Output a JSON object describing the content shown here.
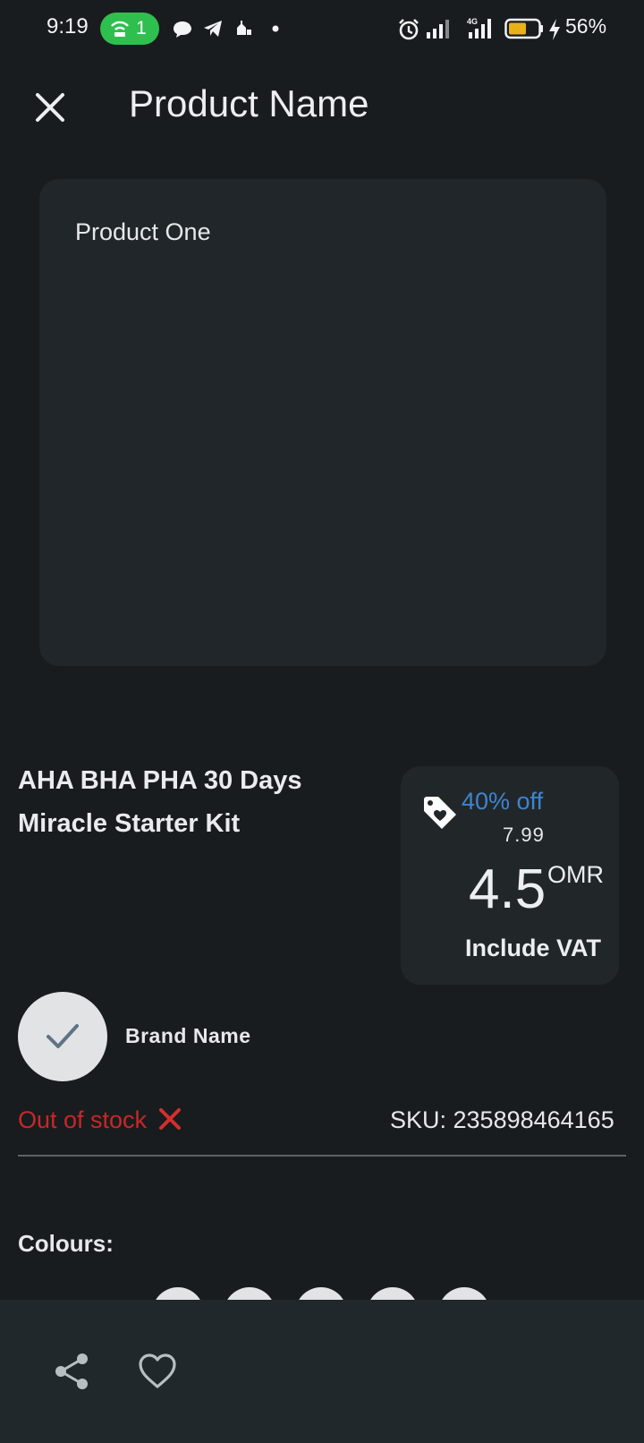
{
  "status_bar": {
    "time": "9:19",
    "hotspot_count": "1",
    "battery": "56%",
    "icons": [
      "hotspot-icon",
      "chat-icon",
      "telegram-icon",
      "notification-icon",
      "dot-icon",
      "alarm-icon",
      "signal-icon",
      "signal-4g-icon",
      "battery-icon",
      "charging-icon"
    ]
  },
  "header": {
    "title": "Product Name",
    "close_icon": "close-icon"
  },
  "image": {
    "label": "Product One"
  },
  "product": {
    "title": "AHA BHA PHA 30 Days Miracle Starter Kit"
  },
  "price": {
    "discount": "40% off",
    "old_price": "7.99",
    "value": "4.5",
    "currency": "OMR",
    "vat_note": "Include VAT",
    "tag_icon": "price-tag-heart-icon"
  },
  "brand": {
    "name": "Brand Name",
    "logo_icon": "check-icon"
  },
  "stock": {
    "status": "Out of stock",
    "status_icon": "cross-icon",
    "sku": "SKU: 235898464165"
  },
  "colours": {
    "label": "Colours:",
    "swatch_count": 5
  },
  "bottom_bar": {
    "share_icon": "share-icon",
    "favorite_icon": "heart-icon"
  },
  "colors": {
    "background": "#191c1e",
    "card": "#202629",
    "accent_blue": "#3f84cf",
    "error_red": "#c62828",
    "hotspot_green": "#2fbf4f",
    "battery_yellow": "#e8b019"
  }
}
